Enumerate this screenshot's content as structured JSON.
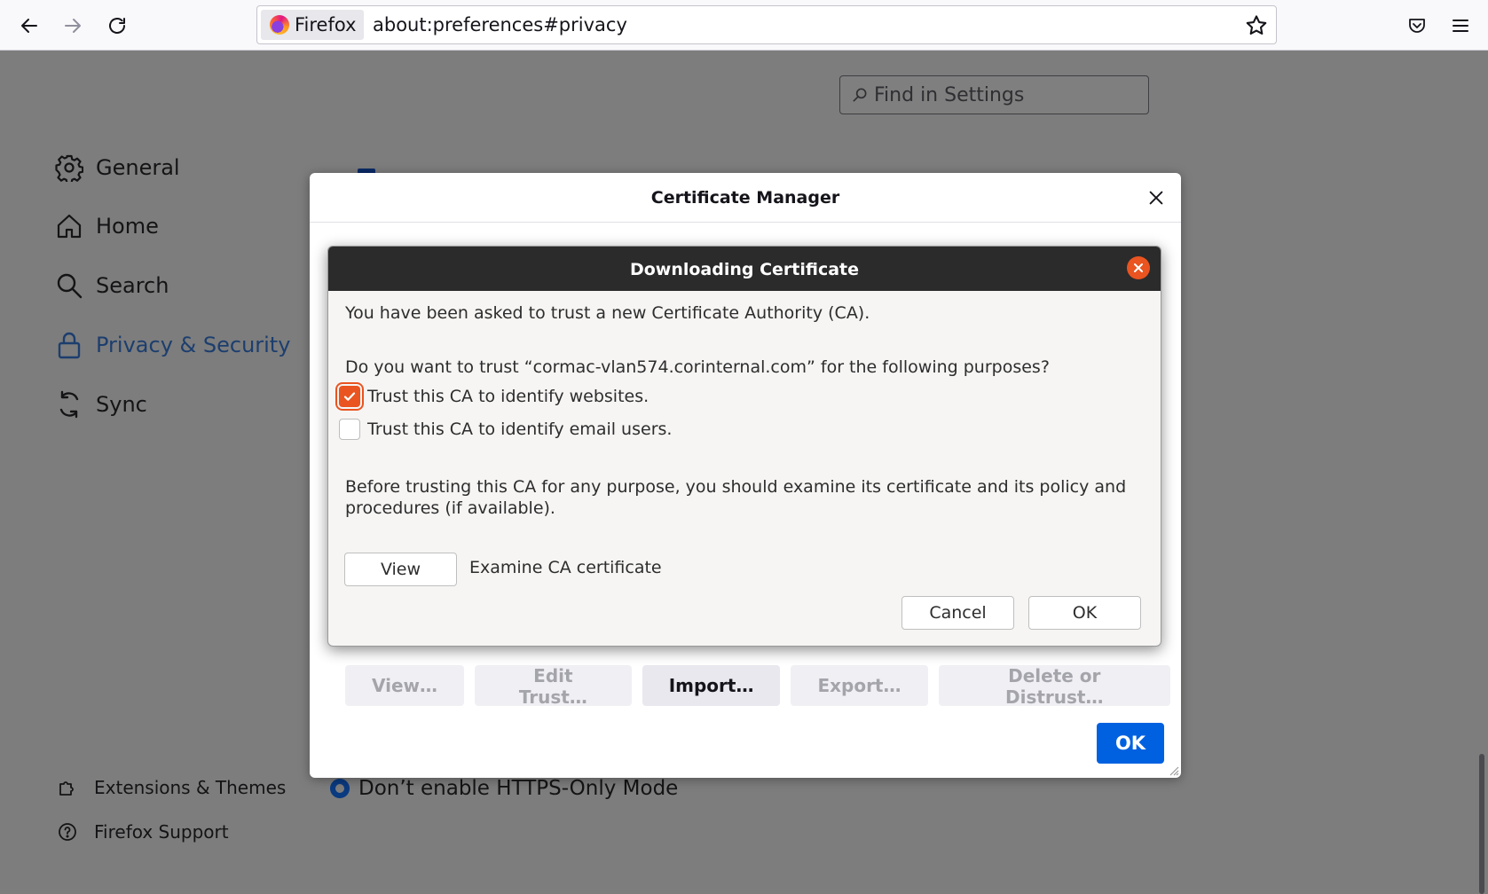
{
  "browser": {
    "identity_label": "Firefox",
    "url": "about:preferences#privacy",
    "icons": [
      "back-icon",
      "forward-icon",
      "reload-icon",
      "bookmark-star-icon",
      "pocket-icon",
      "menu-icon"
    ]
  },
  "preferences": {
    "search_placeholder": "Find in Settings",
    "nav": {
      "general": "General",
      "home": "Home",
      "search": "Search",
      "privacy": "Privacy & Security",
      "sync": "Sync",
      "extensions": "Extensions & Themes",
      "support": "Firefox Support"
    },
    "https_radio_label": "Don’t enable HTTPS-Only Mode"
  },
  "cert_manager": {
    "title": "Certificate Manager",
    "buttons": {
      "view": "View…",
      "edit_trust": "Edit Trust…",
      "import": "Import…",
      "export": "Export…",
      "delete": "Delete or Distrust…"
    },
    "ok": "OK"
  },
  "download_dialog": {
    "title": "Downloading Certificate",
    "intro": "You have been asked to trust a new Certificate Authority (CA).",
    "question": "Do you want to trust “cormac-vlan574.corinternal.com” for the following purposes?",
    "trust_websites": {
      "label": "Trust this CA to identify websites.",
      "checked": true
    },
    "trust_email": {
      "label": "Trust this CA to identify email users.",
      "checked": false
    },
    "advice_line1": "Before trusting this CA for any purpose, you should examine its certificate and its policy and",
    "advice_line2": "procedures (if available).",
    "view_button": "View",
    "view_caption": "Examine CA certificate",
    "cancel": "Cancel",
    "ok": "OK"
  },
  "colors": {
    "ubuntu_orange": "#e95420",
    "firefox_blue": "#0061e0",
    "privacy_active": "#1c3e6e"
  }
}
